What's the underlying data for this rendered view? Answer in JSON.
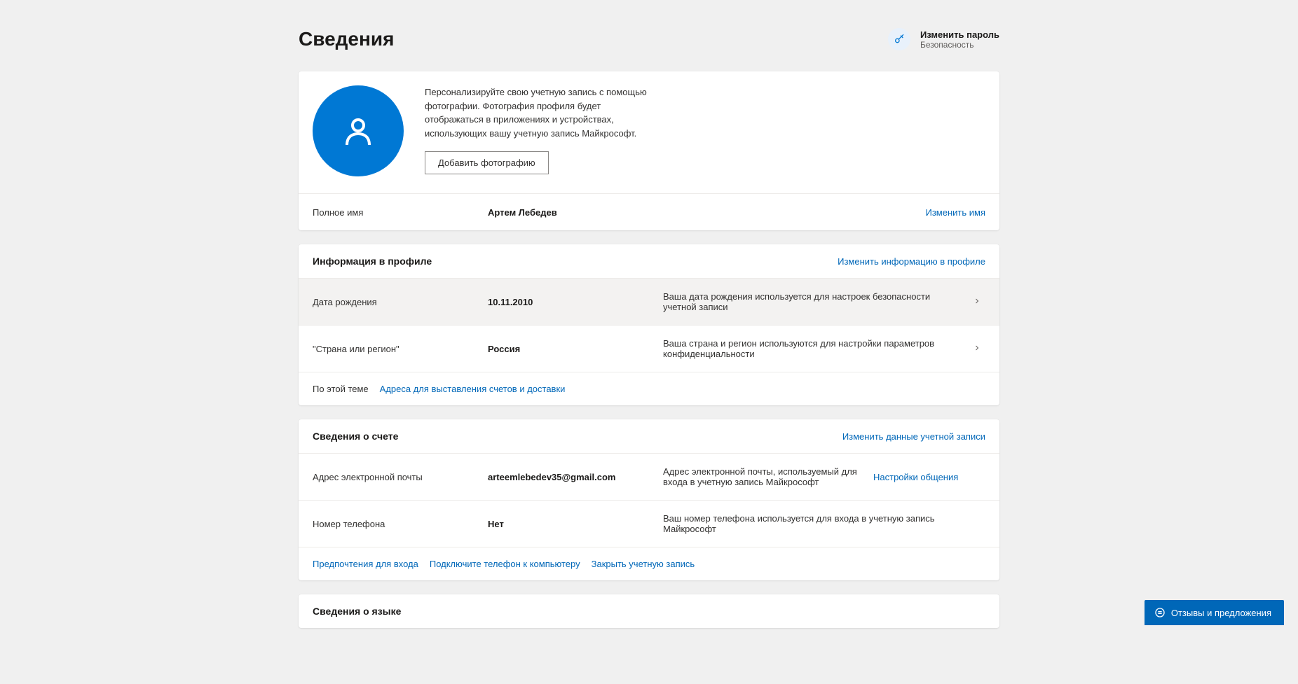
{
  "header": {
    "title": "Сведения",
    "change_password": {
      "title": "Изменить пароль",
      "subtitle": "Безопасность"
    }
  },
  "photo": {
    "description": "Персонализируйте свою учетную запись с помощью фотографии. Фотография профиля будет отображаться в приложениях и устройствах, использующих вашу учетную запись Майкрософт.",
    "add_button": "Добавить фотографию"
  },
  "name_row": {
    "label": "Полное имя",
    "value": "Артем Лебедев",
    "action": "Изменить имя"
  },
  "profile": {
    "title": "Информация в профиле",
    "edit_link": "Изменить информацию в профиле",
    "dob": {
      "label": "Дата рождения",
      "value": "10.11.2010",
      "desc": "Ваша дата рождения используется для настроек безопасности учетной записи"
    },
    "region": {
      "label": "\"Страна или регион\"",
      "value": "Россия",
      "desc": "Ваша страна и регион используются для настройки параметров конфиденциальности"
    },
    "footer_label": "По этой теме",
    "footer_link": "Адреса для выставления счетов и доставки"
  },
  "account": {
    "title": "Сведения о счете",
    "edit_link": "Изменить данные учетной записи",
    "email": {
      "label": "Адрес электронной почты",
      "value": "arteemlebedev35@gmail.com",
      "desc": "Адрес электронной почты, используемый для входа в учетную запись Майкрософт",
      "action": "Настройки общения"
    },
    "phone": {
      "label": "Номер телефона",
      "value": "Нет",
      "desc": "Ваш номер телефона используется для входа в учетную запись Майкрософт"
    },
    "footer_links": {
      "signin_prefs": "Предпочтения для входа",
      "connect_phone": "Подключите телефон к компьютеру",
      "close_account": "Закрыть учетную запись"
    }
  },
  "language": {
    "title": "Сведения о языке"
  },
  "feedback_button": "Отзывы и предложения"
}
